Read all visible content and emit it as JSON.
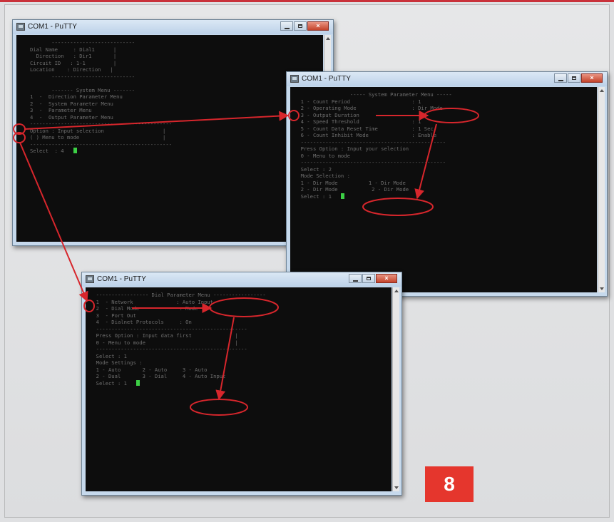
{
  "windows": [
    {
      "title": "COM1 - PuTTY",
      "terminal_lines": [
        "          ---------------------------",
        "   Dial Name     : Dial1      |",
        "     Direction   : Dir1       |",
        "   Circuit ID   : 1-1         |",
        "   Location    : Direction   |",
        "          ---------------------------",
        "",
        "          ------- System Menu -------",
        "   1  -  Direction Parameter Menu",
        "   2  -  System Parameter Menu",
        "   3  -  Parameter Menu",
        "   4  -  Output Parameter Menu",
        "   ----------------------------------------------",
        "   Option : Input selection                   |",
        "   ( ) Menu to mode                           |",
        "   ----------------------------------------------",
        "   Select  : 4   "
      ]
    },
    {
      "title": "COM1 - PuTTY",
      "terminal_lines": [
        "                  ----- System Parameter Menu -----",
        "  1 - Count Period                    : 1",
        "  2 - Operating Mode                  : Dir Mode",
        "  3 - Output Duration",
        "  4 - Speed Threshold                 : 1",
        "  5 - Count Data Reset Time           : 1 Sec",
        "  6 - Count Inhibit Mode              : Enable",
        "  -----------------------------------------------",
        "  Press Option : Input your selection",
        "  0 - Menu to mode",
        "  -----------------------------------------------",
        "  Select : 2",
        "  Mode Selection :",
        "  1 - Dir Mode          1 - Dir Mode",
        "  2 - Dir Mode           2 - Dir Mode",
        "  Select : 1   "
      ]
    },
    {
      "title": "COM1 - PuTTY",
      "terminal_lines": [
        "  ----------------- Dial Parameter Menu -----------------",
        "  1  - Network              : Auto Input",
        "  2  - Dial Mode             : Mode",
        "  3  - Port Out",
        "  4  - Dialnet Protocols     : On",
        "  -------------------------------------------------",
        "  Press Option : Input data first              |",
        "  0 - Menu to mode                             |",
        "  -------------------------------------------------",
        "  Select : 1",
        "  Mode Settings :",
        "  1 - Auto       2 - Auto     3 - Auto",
        "  2 - Dual       3 - Dial     4 - Auto Input",
        "  Select : 1   "
      ]
    }
  ],
  "step_badge": "8",
  "colors": {
    "annotation": "#d7262c",
    "badge": "#e5362d",
    "terminal_bg": "#0d0d0d",
    "cursor": "#3ccf45"
  },
  "icons": {
    "window_icon": "putty-icon",
    "minimize": "minimize-icon",
    "maximize": "maximize-icon",
    "close": "close-icon"
  }
}
